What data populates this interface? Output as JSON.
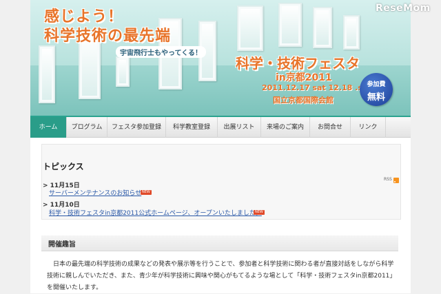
{
  "banner": {
    "catch_line1": "感じよう！",
    "catch_line2": "科学技術の最先端",
    "astronaut": "宇宙飛行士もやってくる！",
    "event_title": "科学・技術フェスタ",
    "event_subtitle": "in京都2011",
    "event_dates": "2011.12.17 sat 12.18 .sun",
    "venue": "国立京都国際会館",
    "free_line1": "参加費",
    "free_line2": "無料",
    "watermark": "ReseMom"
  },
  "nav": {
    "items": [
      {
        "label": "ホーム"
      },
      {
        "label": "プログラム"
      },
      {
        "label": "フェスタ参加登録"
      },
      {
        "label": "科学教室登録"
      },
      {
        "label": "出展リスト"
      },
      {
        "label": "来場のご案内"
      },
      {
        "label": "お問合せ"
      },
      {
        "label": "リンク"
      }
    ]
  },
  "topics": {
    "title": "トピックス",
    "rss_label": "RSS",
    "items": [
      {
        "date": "> 11月15日",
        "text": "サーバーメンテナンスのお知らせ",
        "badge": "NEW"
      },
      {
        "date": "> 11月10日",
        "text": "科学・技術フェスタin京都2011公式ホームページ、オープンいたしました。",
        "badge": "NEW"
      }
    ]
  },
  "purpose": {
    "heading": "開催趣旨",
    "body": "日本の最先端の科学技術の成果などの発表や展示等を行うことで、参加者と科学技術に関わる者が直接対話をしながら科学技術に親しんでいただき、また、青少年が科学技術に興味や関心がもてるような場として「科学・技術フェスタin京都2011」を開催いたします。"
  },
  "colors": {
    "accent": "#2a9d89",
    "orange": "#e8742a",
    "link": "#2a58a7"
  }
}
